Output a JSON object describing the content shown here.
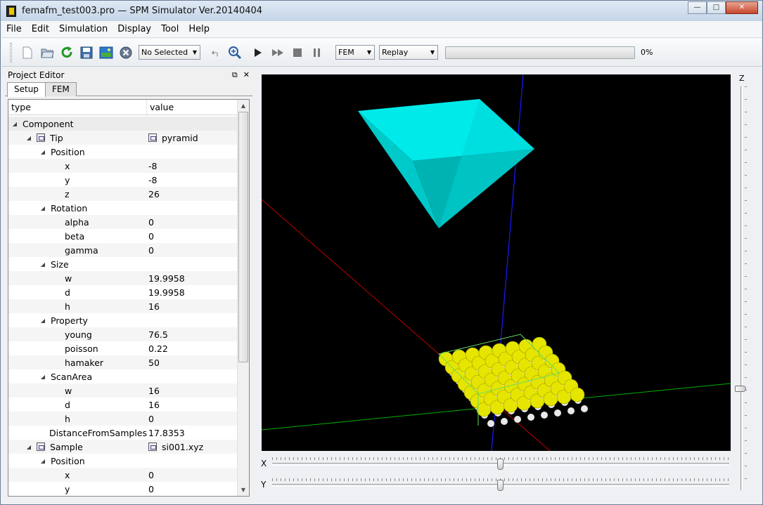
{
  "window": {
    "title": "femafm_test003.pro — SPM Simulator Ver.20140404"
  },
  "window_controls": {
    "minimize": "—",
    "maximize": "□",
    "close": "✕"
  },
  "menu": [
    "File",
    "Edit",
    "Simulation",
    "Display",
    "Tool",
    "Help"
  ],
  "toolbar": {
    "selection_combo": "No Selected",
    "mode_combo": "FEM",
    "replay_combo": "Replay",
    "progress": 0,
    "progress_text": "0%"
  },
  "editor": {
    "title": "Project Editor",
    "float_glyph": "⧉",
    "close_glyph": "✕",
    "tabs": [
      "Setup",
      "FEM"
    ],
    "columns": [
      "type",
      "value"
    ]
  },
  "tree_rows": [
    {
      "label": "Component",
      "value": "",
      "level": 0,
      "exp": true,
      "icon": false
    },
    {
      "label": "Tip",
      "value": "pyramid",
      "level": 1,
      "exp": true,
      "icon": true
    },
    {
      "label": "Position",
      "value": "",
      "level": 2,
      "exp": true,
      "icon": false
    },
    {
      "label": "x",
      "value": "-8",
      "level": 3,
      "exp": false,
      "icon": false
    },
    {
      "label": "y",
      "value": "-8",
      "level": 3,
      "exp": false,
      "icon": false
    },
    {
      "label": "z",
      "value": "26",
      "level": 3,
      "exp": false,
      "icon": false
    },
    {
      "label": "Rotation",
      "value": "",
      "level": 2,
      "exp": true,
      "icon": false
    },
    {
      "label": "alpha",
      "value": "0",
      "level": 3,
      "exp": false,
      "icon": false
    },
    {
      "label": "beta",
      "value": "0",
      "level": 3,
      "exp": false,
      "icon": false
    },
    {
      "label": "gamma",
      "value": "0",
      "level": 3,
      "exp": false,
      "icon": false
    },
    {
      "label": "Size",
      "value": "",
      "level": 2,
      "exp": true,
      "icon": false
    },
    {
      "label": "w",
      "value": "19.9958",
      "level": 3,
      "exp": false,
      "icon": false
    },
    {
      "label": "d",
      "value": "19.9958",
      "level": 3,
      "exp": false,
      "icon": false
    },
    {
      "label": "h",
      "value": "16",
      "level": 3,
      "exp": false,
      "icon": false
    },
    {
      "label": "Property",
      "value": "",
      "level": 2,
      "exp": true,
      "icon": false
    },
    {
      "label": "young",
      "value": "76.5",
      "level": 3,
      "exp": false,
      "icon": false
    },
    {
      "label": "poisson",
      "value": "0.22",
      "level": 3,
      "exp": false,
      "icon": false
    },
    {
      "label": "hamaker",
      "value": "50",
      "level": 3,
      "exp": false,
      "icon": false
    },
    {
      "label": "ScanArea",
      "value": "",
      "level": 2,
      "exp": true,
      "icon": false
    },
    {
      "label": "w",
      "value": "16",
      "level": 3,
      "exp": false,
      "icon": false
    },
    {
      "label": "d",
      "value": "16",
      "level": 3,
      "exp": false,
      "icon": false
    },
    {
      "label": "h",
      "value": "0",
      "level": 3,
      "exp": false,
      "icon": false
    },
    {
      "label": "DistanceFromSamples",
      "value": "17.8353",
      "level": 2,
      "exp": false,
      "icon": false
    },
    {
      "label": "Sample",
      "value": "si001.xyz",
      "level": 1,
      "exp": true,
      "icon": true
    },
    {
      "label": "Position",
      "value": "",
      "level": 2,
      "exp": true,
      "icon": false
    },
    {
      "label": "x",
      "value": "0",
      "level": 3,
      "exp": false,
      "icon": false
    },
    {
      "label": "y",
      "value": "0",
      "level": 3,
      "exp": false,
      "icon": false
    }
  ],
  "viewer": {
    "z_label": "Z",
    "x_label": "X",
    "y_label": "Y",
    "x_slider": 0.5,
    "y_slider": 0.5,
    "z_slider": 0.75,
    "colors": {
      "tip": "#00e5e5",
      "atoms": "#e5e500",
      "axis_x": "#d40000",
      "axis_y": "#00c000",
      "axis_z": "#1a1aff"
    }
  }
}
